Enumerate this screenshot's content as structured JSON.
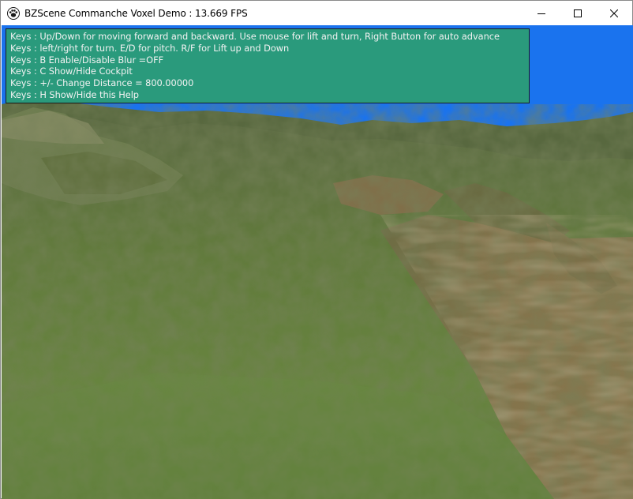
{
  "window": {
    "title": "BZScene Commanche Voxel Demo : 13.669 FPS",
    "app_icon": "paw-icon",
    "controls": {
      "minimize_icon": "minimize-icon",
      "maximize_icon": "maximize-icon",
      "close_icon": "close-icon"
    }
  },
  "help": {
    "lines": [
      "Keys : Up/Down for moving forward and backward. Use mouse for lift and turn, Right Button for auto advance",
      "Keys : left/right for turn. E/D for pitch. R/F for Lift up and Down",
      "Keys : B Enable/Disable Blur =OFF",
      "Keys : C Show/Hide Cockpit",
      "Keys : +/- Change Distance = 800.00000",
      "Keys : H Show/Hide this Help"
    ]
  },
  "scene": {
    "sky_color": "#1a73ee",
    "grass_color": "#5e7c3c",
    "dirt_color": "#8a7048",
    "panel_color": "#2a9a7c"
  }
}
